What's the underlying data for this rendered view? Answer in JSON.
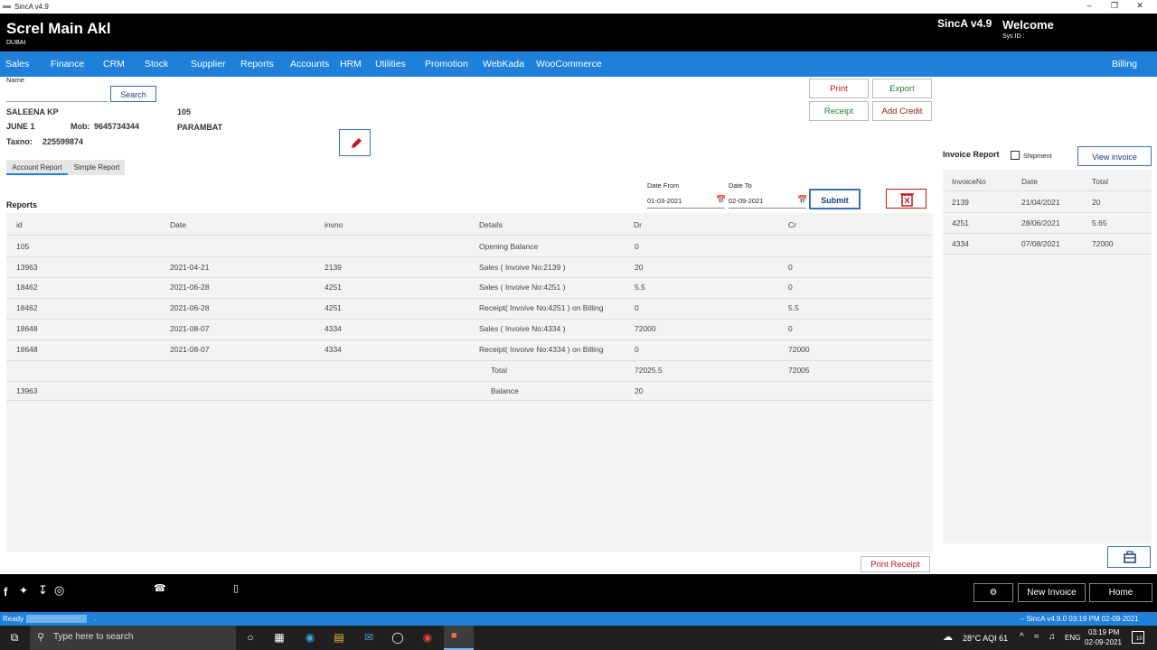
{
  "window": {
    "title": "SincA v4.9"
  },
  "header": {
    "title": "Screl Main Akl",
    "subtitle": "DUBAI",
    "version": "SincA v4.9",
    "welcome": "Welcome",
    "sys_id": "Sys ID :"
  },
  "nav": {
    "items": [
      "Sales",
      "Finance",
      "CRM",
      "Stock",
      "Supplier",
      "Reports",
      "Accounts",
      "HRM",
      "Utilities",
      "Promotion",
      "WebKada",
      "WooCommerce"
    ],
    "right": "Billing"
  },
  "search": {
    "label": "Name",
    "value": "",
    "button": "Search"
  },
  "customer": {
    "name": "SALEENA KP",
    "id": "105",
    "branch": "JUNE 1",
    "mob_label": "Mob:",
    "mob": "9645734344",
    "place": "PARAMBAT",
    "tax_label": "Taxno:",
    "taxno": "225599874"
  },
  "actions": {
    "print": "Print",
    "export": "Export",
    "receipt": "Receipt",
    "add_credit": "Add Credit"
  },
  "tabs": [
    "Account Report",
    "Simple Report"
  ],
  "filter": {
    "date_from_label": "Date From",
    "date_from": "01-03-2021",
    "date_to_label": "Date To",
    "date_to": "02-09-2021",
    "submit": "Submit"
  },
  "reports": {
    "title": "Reports",
    "columns": [
      "id",
      "Date",
      "invno",
      "Details",
      "Dr",
      "Cr"
    ],
    "rows": [
      [
        "105",
        "",
        "",
        "Opening Balance",
        "0",
        ""
      ],
      [
        "13963",
        "2021-04-21",
        "2139",
        "Sales ( Invoive No:2139 )",
        "20",
        "0"
      ],
      [
        "18462",
        "2021-06-28",
        "4251",
        "Sales ( Invoive No:4251 )",
        "5.5",
        "0"
      ],
      [
        "18462",
        "2021-06-28",
        "4251",
        "Receipt( Invoive No:4251 ) on Billing",
        "0",
        "5.5"
      ],
      [
        "18648",
        "2021-08-07",
        "4334",
        "Sales ( Invoive No:4334 )",
        "72000",
        "0"
      ],
      [
        "18648",
        "2021-08-07",
        "4334",
        "Receipt( Invoive No:4334 ) on Billing",
        "0",
        "72000"
      ],
      [
        "",
        "",
        "",
        "Total",
        "72025.5",
        "72005"
      ],
      [
        "13963",
        "",
        "",
        "Balance",
        "20",
        ""
      ]
    ]
  },
  "invoice_report": {
    "title": "Invoice Report",
    "shipment_label": "Shipment",
    "view_button": "View invoice",
    "columns": [
      "InvoiceNo",
      "Date",
      "Total"
    ],
    "rows": [
      [
        "2139",
        "21/04/2021",
        "20"
      ],
      [
        "4251",
        "28/06/2021",
        "5.65"
      ],
      [
        "4334",
        "07/08/2021",
        "72000"
      ]
    ]
  },
  "print_receipt": "Print Receipt",
  "footer": {
    "new_invoice": "New Invoice",
    "home": "Home"
  },
  "status": {
    "left": "Ready",
    "dot": ".",
    "right": "-- SincA v4.9.0   03:19 PM   02-09-2021"
  },
  "taskbar": {
    "search_placeholder": "Type here to search",
    "weather": "28°C  AQI 61",
    "lang": "ENG",
    "time": "03:19 PM",
    "date": "02-09-2021",
    "notif": "10"
  }
}
